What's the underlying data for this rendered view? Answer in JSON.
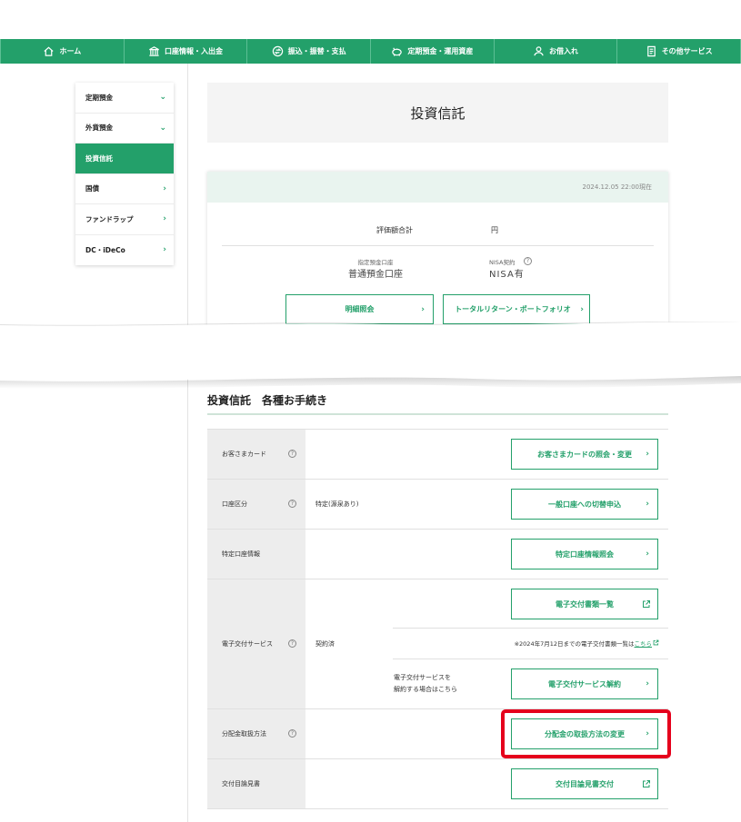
{
  "nav": {
    "items": [
      {
        "label": "ホーム",
        "icon": "home-icon"
      },
      {
        "label": "口座情報・入出金",
        "icon": "bank-icon"
      },
      {
        "label": "振込・振替・支払",
        "icon": "transfer-icon"
      },
      {
        "label": "定期預金・運用資産",
        "icon": "piggy-bank-icon"
      },
      {
        "label": "お借入れ",
        "icon": "loan-icon"
      },
      {
        "label": "その他サービス",
        "icon": "document-icon"
      }
    ]
  },
  "sidebar": {
    "items": [
      {
        "label": "定期預金",
        "indicator": "chevron-down"
      },
      {
        "label": "外貨預金",
        "indicator": "chevron-down"
      },
      {
        "label": "投資信託",
        "indicator": "none",
        "active": true
      },
      {
        "label": "国債",
        "indicator": "chevron-right"
      },
      {
        "label": "ファンドラップ",
        "indicator": "chevron-right"
      },
      {
        "label": "DC・iDeCo",
        "indicator": "chevron-right"
      }
    ]
  },
  "page": {
    "title": "投資信託"
  },
  "summary": {
    "timestamp": "2024.12.05 22:00現在",
    "total_label": "評価額合計",
    "total_unit": "円",
    "account_label": "指定預金口座",
    "account_value": "普通預金口座",
    "nisa_label": "NISA契約",
    "nisa_value": "NISA有",
    "detail_button": "明細照会",
    "portfolio_button": "トータルリターン・ポートフォリオ"
  },
  "procedures": {
    "title": "投資信託　各種お手続き",
    "rows": {
      "card": {
        "label": "お客さまカード",
        "value": "",
        "button": "お客さまカードの照会・変更"
      },
      "account_type": {
        "label": "口座区分",
        "value": "特定(源泉あり)",
        "button": "一般口座への切替申込"
      },
      "specific_account": {
        "label": "特定口座情報",
        "value": "",
        "button": "特定口座情報照会"
      },
      "e_delivery": {
        "label": "電子交付サービス",
        "value": "契約済",
        "button_list": "電子交付書類一覧",
        "note_prefix": "※2024年7月12日までの電子交付書類一覧は",
        "note_link": "こちら",
        "cancel_note_line1": "電子交付サービスを",
        "cancel_note_line2": "解約する場合はこちら",
        "button_cancel": "電子交付サービス解約"
      },
      "distribution": {
        "label": "分配金取扱方法",
        "value": "",
        "button": "分配金の取扱方法の変更"
      },
      "prospectus": {
        "label": "交付目論見書",
        "value": "",
        "button": "交付目論見書交付"
      }
    }
  },
  "colors": {
    "brand_green": "#23a06a",
    "highlight_red": "#e5001c",
    "label_bg": "#ededed",
    "card_head_bg": "#e9f4ef"
  }
}
